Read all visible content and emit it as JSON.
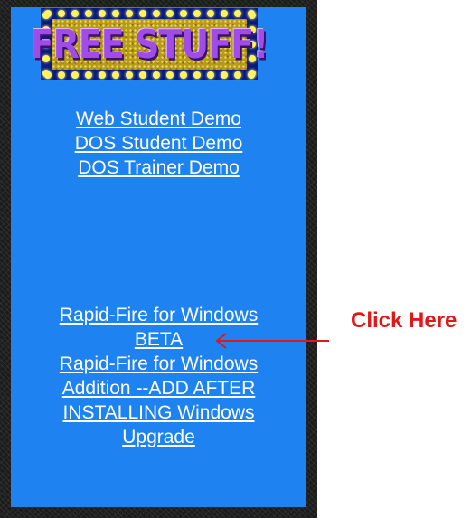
{
  "banner": {
    "text": "FREE STUFF!"
  },
  "links_top": [
    "Web Student Demo",
    "DOS Student Demo",
    "DOS Trainer Demo"
  ],
  "links_bottom": [
    "Rapid-Fire for Windows",
    "BETA",
    "Rapid-Fire for Windows",
    "Addition --ADD AFTER",
    "INSTALLING Windows",
    "Upgrade"
  ],
  "annotation": {
    "text": "Click Here",
    "color": "#e01818"
  },
  "colors": {
    "panel_blue": "#1e82f0",
    "frame_dark": "#1c1c1c",
    "link": "#ffffff"
  },
  "icons": {
    "arrow": "left-arrow-icon"
  }
}
